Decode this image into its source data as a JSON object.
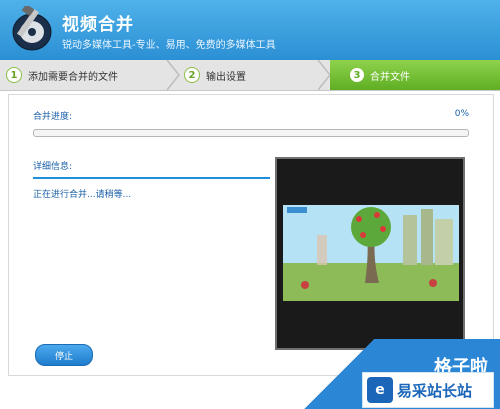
{
  "header": {
    "title": "视频合并",
    "subtitle": "锐动多媒体工具-专业、易用、免费的多媒体工具"
  },
  "steps": [
    {
      "num": "1",
      "label": "添加需要合并的文件"
    },
    {
      "num": "2",
      "label": "输出设置"
    },
    {
      "num": "3",
      "label": "合并文件"
    }
  ],
  "progress": {
    "label": "合并进度:",
    "percent_text": "0%",
    "value": 0
  },
  "details": {
    "label": "详细信息:",
    "status": "正在进行合并...请稍等..."
  },
  "buttons": {
    "stop": "停止"
  },
  "watermark": {
    "top": "格子啦",
    "bottom": "易采站长站"
  },
  "colors": {
    "header": "#3aa0e0",
    "active_step": "#6bbb2f",
    "accent": "#1e8fdf"
  }
}
